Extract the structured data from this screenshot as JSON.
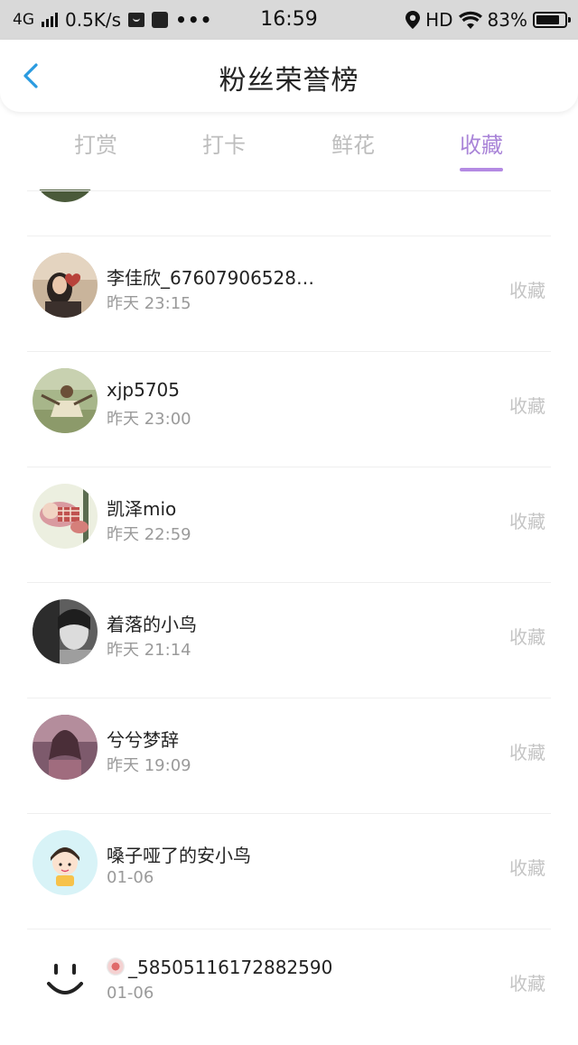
{
  "status_bar": {
    "network": "4G",
    "speed": "0.5K/s",
    "time": "16:59",
    "hd": "HD",
    "battery": "83%",
    "battery_level": 0.83
  },
  "header": {
    "title": "粉丝荣誉榜"
  },
  "tabs": [
    {
      "label": "打赏",
      "active": false
    },
    {
      "label": "打卡",
      "active": false
    },
    {
      "label": "鲜花",
      "active": false
    },
    {
      "label": "收藏",
      "active": true
    }
  ],
  "colors": {
    "accent": "#a984d8",
    "muted": "#c4c4c4"
  },
  "fans": [
    {
      "name": "李佳欣_67607906528…",
      "time": "昨天 23:15",
      "action": "收藏",
      "avatar": "avatar-girl-heart"
    },
    {
      "name": "xjp5705",
      "time": "昨天 23:00",
      "action": "收藏",
      "avatar": "avatar-boy-sitting"
    },
    {
      "name": "凯泽mio",
      "time": "昨天 22:59",
      "action": "收藏",
      "avatar": "avatar-plush-toy"
    },
    {
      "name": "着落的小鸟",
      "time": "昨天 21:14",
      "action": "收藏",
      "avatar": "avatar-bw-portrait"
    },
    {
      "name": "兮兮梦辞",
      "time": "昨天 19:09",
      "action": "收藏",
      "avatar": "avatar-anime-girl"
    },
    {
      "name": "嗓子哑了的安小鸟",
      "time": "01-06",
      "action": "收藏",
      "avatar": "avatar-cartoon-girl"
    },
    {
      "name": "_58505116172882590",
      "time": "01-06",
      "action": "收藏",
      "avatar": "avatar-smiley"
    }
  ]
}
